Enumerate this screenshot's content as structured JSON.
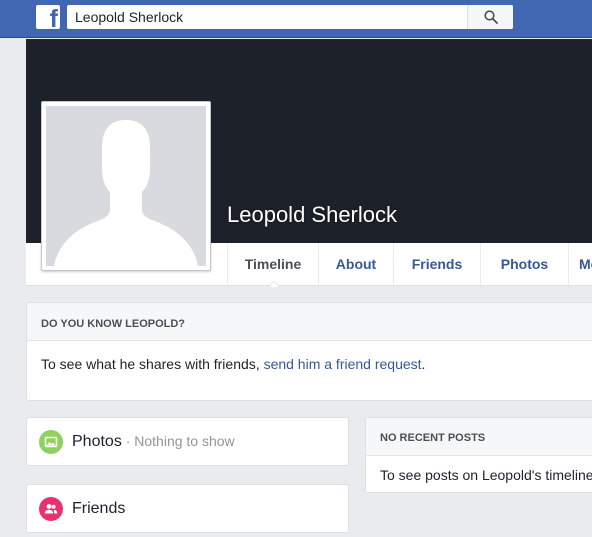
{
  "topbar": {
    "logo_letter": "f",
    "search_value": "Leopold Sherlock"
  },
  "profile": {
    "name": "Leopold Sherlock"
  },
  "tabs": [
    {
      "label": "Timeline",
      "active": true
    },
    {
      "label": "About"
    },
    {
      "label": "Friends"
    },
    {
      "label": "Photos"
    },
    {
      "label": "Mo"
    }
  ],
  "know_card": {
    "heading": "DO YOU KNOW LEOPOLD?",
    "text_before": "To see what he shares with friends, ",
    "link": "send him a friend request",
    "text_after": "."
  },
  "photos_card": {
    "title": "Photos",
    "separator": " · ",
    "subtitle": "Nothing to show"
  },
  "friends_card": {
    "title": "Friends"
  },
  "posts_card": {
    "heading": "NO RECENT POSTS",
    "text": "To see posts on Leopold's timeline"
  },
  "colors": {
    "brand_blue": "#4267b2",
    "link_blue": "#365899",
    "photos_icon": "#8ed15f",
    "friends_icon": "#e9316e"
  },
  "icons": [
    "facebook-logo-icon",
    "search-icon",
    "default-avatar-icon",
    "photos-icon",
    "friends-icon"
  ]
}
